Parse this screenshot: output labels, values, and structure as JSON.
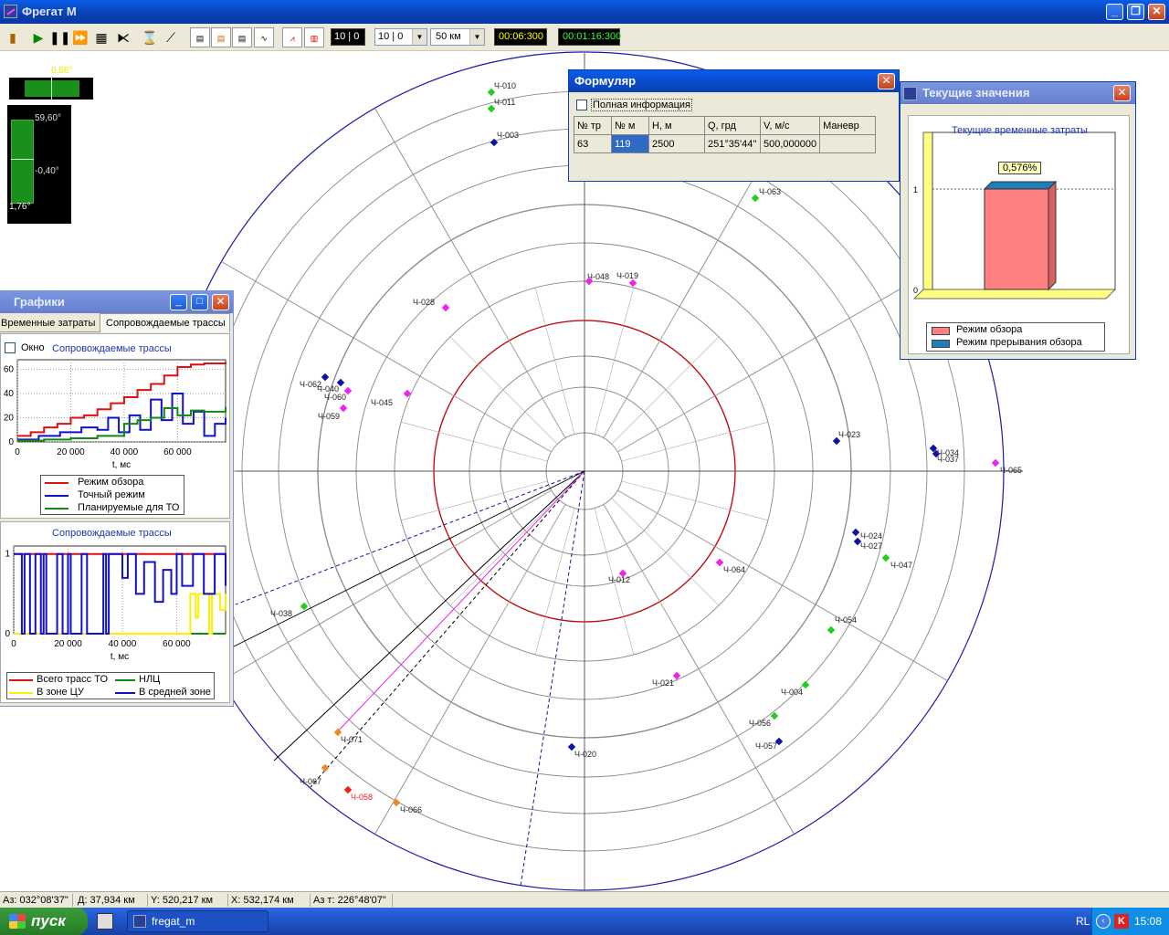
{
  "app": {
    "title": "Фрегат М"
  },
  "toolbar": {
    "field_a": "10 | 0",
    "field_b": "10 | 0",
    "range_value": "50 км",
    "time_1": "00:06:300",
    "time_2": "00:01:16:300"
  },
  "indicators": {
    "horizontal_label": "0,58°",
    "vertical_top": "59,60°",
    "vertical_mid": "-0,40°",
    "vertical_bottom": "1,76°"
  },
  "radar_tracks": [
    {
      "label": "Ч-010",
      "color": "#22cc22"
    },
    {
      "label": "Ч-011",
      "color": "#22cc22"
    },
    {
      "label": "Ч-003",
      "color": "#1111aa"
    },
    {
      "label": "Ч-063",
      "color": "#22cc22"
    },
    {
      "label": "Ч-048",
      "color": "#ee22ee"
    },
    {
      "label": "Ч-019",
      "color": "#ee22ee"
    },
    {
      "label": "Ч-028",
      "color": "#ee22ee"
    },
    {
      "label": "Ч-062",
      "color": "#1111aa"
    },
    {
      "label": "Ч-040",
      "color": "#1111aa"
    },
    {
      "label": "Ч-060",
      "color": "#ee22ee"
    },
    {
      "label": "Ч-059",
      "color": "#ee22ee"
    },
    {
      "label": "Ч-045",
      "color": "#ee22ee"
    },
    {
      "label": "Ч-023",
      "color": "#1111aa"
    },
    {
      "label": "Ч-034",
      "color": "#1111aa"
    },
    {
      "label": "Ч-037",
      "color": "#1111aa"
    },
    {
      "label": "Ч-065",
      "color": "#ee22ee"
    },
    {
      "label": "Ч-024",
      "color": "#1111aa"
    },
    {
      "label": "Ч-027",
      "color": "#1111aa"
    },
    {
      "label": "Ч-047",
      "color": "#22cc22"
    },
    {
      "label": "Ч-064",
      "color": "#ee22ee"
    },
    {
      "label": "Ч-012",
      "color": "#ee22ee"
    },
    {
      "label": "Ч-038",
      "color": "#22cc22"
    },
    {
      "label": "Ч-054",
      "color": "#22cc22"
    },
    {
      "label": "Ч-021",
      "color": "#ee22ee"
    },
    {
      "label": "Ч-004",
      "color": "#22cc22"
    },
    {
      "label": "Ч-056",
      "color": "#22cc22"
    },
    {
      "label": "Ч-057",
      "color": "#1111aa"
    },
    {
      "label": "Ч-020",
      "color": "#1111aa"
    },
    {
      "label": "Ч-071",
      "color": "#ee8822"
    },
    {
      "label": "Ч-058",
      "color": "#ee2222"
    },
    {
      "label": "Ч-066",
      "color": "#ee8822"
    },
    {
      "label": "Ч-067",
      "color": "#ee8822"
    }
  ],
  "formular": {
    "title": "Формуляр",
    "full_info_label": "Полная информация",
    "headers": [
      "№ тр",
      "№ м",
      "Н, м",
      "Q, грд",
      "V, м/с",
      "Маневр"
    ],
    "row": [
      "63",
      "119",
      "2500",
      "251°35'44''",
      "500,000000",
      ""
    ]
  },
  "current": {
    "title": "Текущие значения",
    "chart_title": "Текущие временные затраты",
    "value_label": "0,576%",
    "legend": [
      "Режим обзора",
      "Режим прерывания обзора"
    ],
    "chart_data": {
      "type": "bar",
      "title": "Текущие временные затраты",
      "series": [
        {
          "name": "Режим обзора",
          "values": [
            1.0
          ],
          "color": "#ff8080"
        },
        {
          "name": "Режим прерывания обзора",
          "values": [
            0.00576
          ],
          "color": "#1e7fb8"
        }
      ],
      "ylim": [
        0,
        1.2
      ],
      "yticks": [
        "0",
        "1"
      ]
    }
  },
  "graphs": {
    "title": "Графики",
    "tab1": "Временные затраты",
    "tab2": "Сопровождаемые трассы",
    "window_checkbox": "Окно",
    "chart1_title": "Сопровождаемые трассы",
    "chart2_title": "Сопровождаемые трассы",
    "xlabel": "t, мс",
    "chart1_legend": [
      "Режим обзора",
      "Точный режим",
      "Планируемые для ТО"
    ],
    "chart2_legend": [
      "Всего трасс ТО",
      "НЛЦ",
      "В зоне ЦУ",
      "В средней зоне"
    ],
    "chart_data": [
      {
        "type": "line",
        "title": "Сопровождаемые трассы",
        "xlabel": "t, мс",
        "xlim": [
          0,
          78000
        ],
        "ylim": [
          0,
          68
        ],
        "xticks": [
          "0",
          "20 000",
          "40 000",
          "60 000"
        ],
        "yticks": [
          "0",
          "20",
          "40",
          "60"
        ],
        "series": [
          {
            "name": "Режим обзора",
            "color": "#dd1111",
            "x": [
              0,
              5000,
              10000,
              15000,
              20000,
              25000,
              30000,
              35000,
              40000,
              45000,
              50000,
              55000,
              60000,
              65000,
              70000,
              78000
            ],
            "y": [
              5,
              8,
              12,
              15,
              20,
              22,
              27,
              32,
              37,
              43,
              48,
              55,
              62,
              64,
              65,
              66
            ]
          },
          {
            "name": "Точный режим",
            "color": "#1111cc",
            "x": [
              0,
              8000,
              16000,
              24000,
              30000,
              34000,
              38000,
              42000,
              46000,
              50000,
              54000,
              58000,
              62000,
              66000,
              70000,
              74000,
              78000
            ],
            "y": [
              2,
              5,
              8,
              12,
              10,
              20,
              8,
              22,
              10,
              35,
              18,
              40,
              15,
              25,
              5,
              15,
              20
            ]
          },
          {
            "name": "Планируемые для ТО",
            "color": "#118811",
            "x": [
              0,
              10000,
              20000,
              30000,
              40000,
              45000,
              50000,
              55000,
              60000,
              65000,
              70000,
              78000
            ],
            "y": [
              1,
              2,
              3,
              5,
              15,
              18,
              20,
              28,
              22,
              26,
              25,
              29
            ]
          }
        ]
      },
      {
        "type": "line",
        "title": "Сопровождаемые трассы",
        "xlabel": "t, мс",
        "xlim": [
          0,
          78000
        ],
        "ylim": [
          0,
          1.1
        ],
        "xticks": [
          "0",
          "20 000",
          "40 000",
          "60 000"
        ],
        "yticks": [
          "0",
          "1"
        ],
        "series": [
          {
            "name": "Всего трасс ТО",
            "color": "#dd1111",
            "x": [
              0,
              78000
            ],
            "y": [
              1,
              1
            ]
          },
          {
            "name": "НЛЦ",
            "color": "#118811",
            "x": [
              0,
              78000
            ],
            "y": [
              0,
              0
            ]
          },
          {
            "name": "В зоне ЦУ",
            "color": "#ffee00",
            "x": [
              0,
              64000,
              65000,
              67000,
              68000,
              72000,
              73000,
              76000,
              78000
            ],
            "y": [
              0,
              0,
              0.5,
              0.2,
              0.5,
              0,
              0.5,
              0.3,
              0.5
            ]
          },
          {
            "name": "В средней зоне",
            "color": "#1111cc",
            "x": [
              0,
              2000,
              3000,
              4000,
              6000,
              8000,
              10000,
              11000,
              12000,
              14000,
              16000,
              18000,
              20000,
              21000,
              23000,
              25000,
              27000,
              30000,
              33000,
              34000,
              35000,
              40000,
              42000,
              45000,
              48000,
              52000,
              55000,
              58000,
              60000,
              62000,
              66000,
              70000,
              74000,
              78000
            ],
            "y": [
              1,
              1,
              0,
              1,
              0,
              1,
              0,
              1,
              0,
              0,
              1,
              0,
              1,
              0,
              0,
              1,
              0,
              0,
              1,
              0,
              1,
              0.7,
              1,
              0.5,
              0.9,
              0.4,
              0.8,
              0.5,
              1,
              0.6,
              1,
              0.5,
              1,
              0.6
            ]
          }
        ]
      }
    ]
  },
  "status": {
    "az": "Аз: 032°08'37\"",
    "d": "Д:  37,934 км",
    "y": "Y: 520,217 км",
    "x": "X: 532,174 км",
    "azt": "Аз т: 226°48'07\""
  },
  "taskbar": {
    "start": "пуск",
    "task": "fregat_m",
    "lang": "RL",
    "clock": "15:08"
  }
}
